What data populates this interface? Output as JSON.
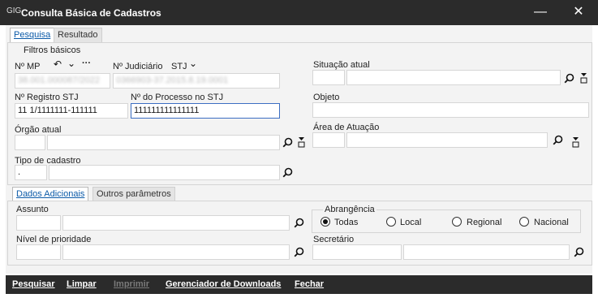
{
  "window": {
    "title": "Consulta Básica de Cadastros",
    "app_icon": "GIG",
    "minimize": "—",
    "close": "✕"
  },
  "tabs": [
    "Pesquisa",
    "Resultado"
  ],
  "filtros": {
    "group_label": "Filtros básicos",
    "nmp_label": "Nº MP",
    "nmp_tools": {
      "undo": "↶",
      "down": "⌄",
      "more": "···"
    },
    "nmp_value": "38.001.000087/2022",
    "judiciario_label": "Nº Judiciário",
    "stj_label": "STJ",
    "judiciario_value": "0366903-37.2015.8.19.0001",
    "registro_label": "Nº Registro STJ",
    "registro_value": "11 1/1111111-111111",
    "processo_label": "Nº do Processo no STJ",
    "processo_value": "111111111111111",
    "orgao_label": "Órgão atual",
    "tipo_label": "Tipo de cadastro",
    "tipo_value": ".",
    "situacao_label": "Situação atual",
    "objeto_label": "Objeto",
    "area_label": "Área de Atuação"
  },
  "subtabs": [
    "Dados Adicionais",
    "Outros parâmetros"
  ],
  "adicionais": {
    "assunto_label": "Assunto",
    "nivel_label": "Nível de prioridade",
    "abrangencia_label": "Abrangência",
    "radios": [
      {
        "label": "Todas",
        "checked": true
      },
      {
        "label": "Local",
        "checked": false
      },
      {
        "label": "Regional",
        "checked": false
      },
      {
        "label": "Nacional",
        "checked": false
      }
    ],
    "secretario_label": "Secretário"
  },
  "icons": {
    "search": "⚲",
    "filter": "⊻"
  },
  "bottom": {
    "pesquisar": "Pesquisar",
    "limpar": "Limpar",
    "imprimir": "Imprimir",
    "gerenciador": "Gerenciador de Downloads",
    "fechar": "Fechar"
  }
}
